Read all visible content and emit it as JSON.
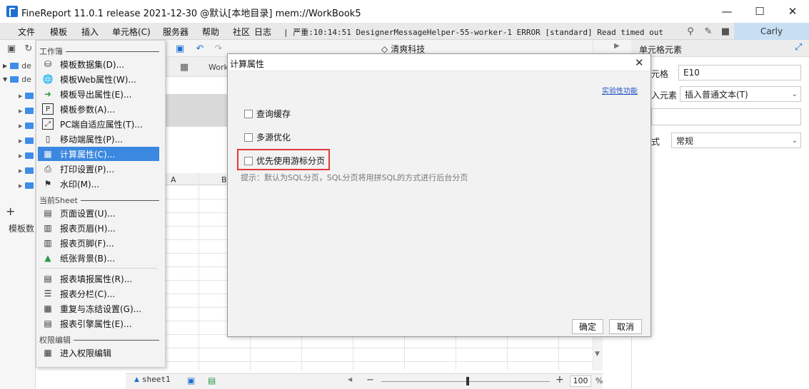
{
  "window": {
    "title": "FineReport 11.0.1 release 2021-12-30 @默认[本地目录]    mem://WorkBook5",
    "minimize": "—",
    "maximize": "☐",
    "close": "✕"
  },
  "menubar": {
    "items": [
      "文件",
      "模板",
      "插入",
      "单元格(C)",
      "服务器",
      "帮助",
      "社区",
      "日志"
    ],
    "status": "| 严重:10:14:51 DesignerMessageHelper-55-worker-1 ERROR [standard] Read timed out",
    "user": "Carly"
  },
  "left_panel": {
    "tree": [
      "de",
      "de"
    ],
    "bottom_label": "模板数"
  },
  "workbook_tab": "Work",
  "toolbar": {
    "brand_text": "清爽科技"
  },
  "grid": {
    "columns": [
      "A",
      "B"
    ]
  },
  "template_menu": {
    "sections": [
      "工作簿",
      "当前Sheet",
      "权限编辑"
    ],
    "workbook_items": [
      {
        "label": "模板数据集(D)...",
        "icon": "database-icon"
      },
      {
        "label": "模板Web属性(W)...",
        "icon": "globe-icon"
      },
      {
        "label": "模板导出属性(E)...",
        "icon": "export-icon"
      },
      {
        "label": "模板参数(A)...",
        "icon": "parameter-icon"
      },
      {
        "label": "PC端自适应属性(T)...",
        "icon": "resize-icon"
      },
      {
        "label": "移动端属性(P)...",
        "icon": "mobile-icon"
      },
      {
        "label": "计算属性(C)...",
        "icon": "calculator-icon"
      },
      {
        "label": "打印设置(P)...",
        "icon": "printer-icon"
      },
      {
        "label": "水印(M)...",
        "icon": "stamp-icon"
      }
    ],
    "sheet_items": [
      {
        "label": "页面设置(U)...",
        "icon": "page-setup-icon"
      },
      {
        "label": "报表页眉(H)...",
        "icon": "header-icon"
      },
      {
        "label": "报表页脚(F)...",
        "icon": "footer-icon"
      },
      {
        "label": "纸张背景(B)...",
        "icon": "image-icon"
      },
      {
        "label": "报表填报属性(R)...",
        "icon": "form-icon"
      },
      {
        "label": "报表分栏(C)...",
        "icon": "columns-icon"
      },
      {
        "label": "重复与冻结设置(G)...",
        "icon": "freeze-icon"
      },
      {
        "label": "报表引擎属性(E)...",
        "icon": "engine-icon"
      }
    ],
    "permission_items": [
      {
        "label": "进入权限编辑",
        "icon": "permission-icon"
      }
    ],
    "active_item": "计算属性(C)..."
  },
  "dialog": {
    "title": "计算属性",
    "experimental_link": "实验性功能",
    "options": [
      {
        "label": "查询缓存",
        "checked": false
      },
      {
        "label": "多源优化",
        "checked": false
      },
      {
        "label": "优先使用游标分页",
        "checked": false
      }
    ],
    "hint": "提示：默认为SQL分页，SQL分页将用拼SQL的方式进行后台分页",
    "ok": "确定",
    "cancel": "取消",
    "highlight_color": "#e03a3a"
  },
  "right_panel": {
    "title": "单元格元素",
    "cell_label": "元格",
    "cell_value": "E10",
    "insert_label": "入元素",
    "insert_value": "插入普通文本(T)",
    "style_label": "式",
    "style_value": "常规"
  },
  "bottom": {
    "sheet_tab": "sheet1",
    "zoom": "100",
    "zoom_unit": "%"
  },
  "colors": {
    "accent": "#3b88e0",
    "user_bg": "#c8def3",
    "link": "#1f52c4"
  }
}
